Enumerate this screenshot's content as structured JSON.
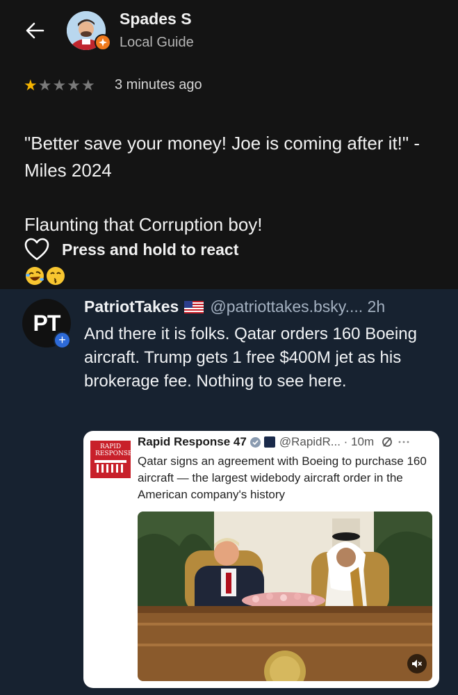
{
  "review": {
    "user_name": "Spades S",
    "user_subtitle": "Local Guide",
    "rating": 1,
    "rating_max": 5,
    "time_ago": "3 minutes ago",
    "text_line1": "\"Better save your money! Joe is coming after it!\" - Miles 2024",
    "text_line2": "Flaunting that Corruption boy!",
    "emojis": [
      "rolling-on-floor-laughing",
      "kissing-face-smiling-eyes"
    ],
    "react_label": "Press and hold to react"
  },
  "post": {
    "avatar_text": "PT",
    "author": "PatriotTakes",
    "handle_time": "@patriottakes.bsky.... 2h",
    "body": "And there it is folks. Qatar orders 160 Boeing aircraft. Trump gets 1 free $400M jet as his brokerage fee. Nothing to see here."
  },
  "quote": {
    "logo_text": "RAPID RESPONSE",
    "author": "Rapid Response 47",
    "handle_time": "@RapidR... · 10m",
    "text": "Qatar signs an agreement with Boeing to purchase 160 aircraft — the largest widebody aircraft order in the American company's history"
  },
  "colors": {
    "review_bg": "#141414",
    "post_bg": "#172230",
    "star_filled": "#f5b400",
    "star_empty": "#7a7a7a",
    "badge_orange": "#f07a1d",
    "logo_red": "#c8202a"
  },
  "icons": [
    "back-arrow-icon",
    "heart-outline-icon",
    "plus-icon",
    "us-flag-icon",
    "verified-icon",
    "mute-icon",
    "sync-icon",
    "more-icon"
  ]
}
